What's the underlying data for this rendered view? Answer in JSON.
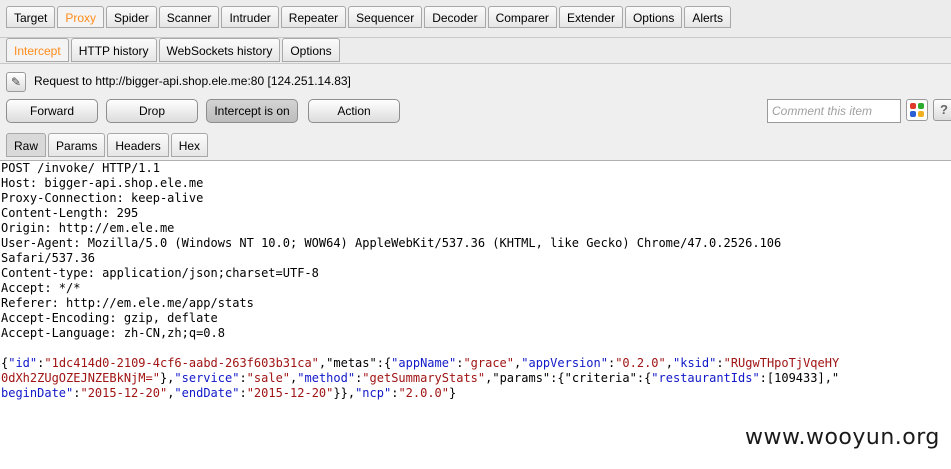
{
  "top_tabs": [
    "Target",
    "Proxy",
    "Spider",
    "Scanner",
    "Intruder",
    "Repeater",
    "Sequencer",
    "Decoder",
    "Comparer",
    "Extender",
    "Options",
    "Alerts"
  ],
  "sub_tabs": [
    "Intercept",
    "HTTP history",
    "WebSockets history",
    "Options"
  ],
  "request_info": "Request to http://bigger-api.shop.ele.me:80  [124.251.14.83]",
  "buttons": {
    "forward": "Forward",
    "drop": "Drop",
    "intercept": "Intercept is on",
    "action": "Action"
  },
  "comment_placeholder": "Comment this item",
  "help_label": "?",
  "highlight_colors": [
    "#e03a2a",
    "#2eaa2e",
    "#2a5fd8",
    "#f0b020"
  ],
  "view_tabs": [
    "Raw",
    "Params",
    "Headers",
    "Hex"
  ],
  "headers": [
    "POST /invoke/ HTTP/1.1",
    "Host: bigger-api.shop.ele.me",
    "Proxy-Connection: keep-alive",
    "Content-Length: 295",
    "Origin: http://em.ele.me",
    "User-Agent: Mozilla/5.0 (Windows NT 10.0; WOW64) AppleWebKit/537.36 (KHTML, like Gecko) Chrome/47.0.2526.106",
    "Safari/537.36",
    "Content-type: application/json;charset=UTF-8",
    "Accept: */*",
    "Referer: http://em.ele.me/app/stats",
    "Accept-Encoding: gzip, deflate",
    "Accept-Language: zh-CN,zh;q=0.8"
  ],
  "body_lines": [
    [
      [
        "p",
        "{"
      ],
      [
        "k",
        "\"id\""
      ],
      [
        "p",
        ":"
      ],
      [
        "v",
        "\"1dc414d0-2109-4cf6-aabd-263f603b31ca\""
      ],
      [
        "p",
        ",\"metas\":{"
      ],
      [
        "k",
        "\"appName\""
      ],
      [
        "p",
        ":"
      ],
      [
        "v",
        "\"grace\""
      ],
      [
        "p",
        ","
      ],
      [
        "k",
        "\"appVersion\""
      ],
      [
        "p",
        ":"
      ],
      [
        "v",
        "\"0.2.0\""
      ],
      [
        "p",
        ","
      ],
      [
        "k",
        "\"ksid\""
      ],
      [
        "p",
        ":"
      ],
      [
        "v",
        "\"RUgwTHpoTjVqeHY"
      ]
    ],
    [
      [
        "v",
        "0dXh2ZUgOZEJNZEBkNjM=\""
      ],
      [
        "p",
        "},"
      ],
      [
        "k",
        "\"service\""
      ],
      [
        "p",
        ":"
      ],
      [
        "v",
        "\"sale\""
      ],
      [
        "p",
        ","
      ],
      [
        "k",
        "\"method\""
      ],
      [
        "p",
        ":"
      ],
      [
        "v",
        "\"getSummaryStats\""
      ],
      [
        "p",
        ",\"params\":{\"criteria\":{"
      ],
      [
        "k",
        "\"restaurantIds\""
      ],
      [
        "p",
        ":[109433],\""
      ]
    ],
    [
      [
        "k",
        "beginDate\""
      ],
      [
        "p",
        ":"
      ],
      [
        "v",
        "\"2015-12-20\""
      ],
      [
        "p",
        ","
      ],
      [
        "k",
        "\"endDate\""
      ],
      [
        "p",
        ":"
      ],
      [
        "v",
        "\"2015-12-20\""
      ],
      [
        "p",
        "}},"
      ],
      [
        "k",
        "\"ncp\""
      ],
      [
        "p",
        ":"
      ],
      [
        "v",
        "\"2.0.0\""
      ],
      [
        "p",
        "}"
      ]
    ]
  ],
  "watermark": "www.wooyun.org"
}
